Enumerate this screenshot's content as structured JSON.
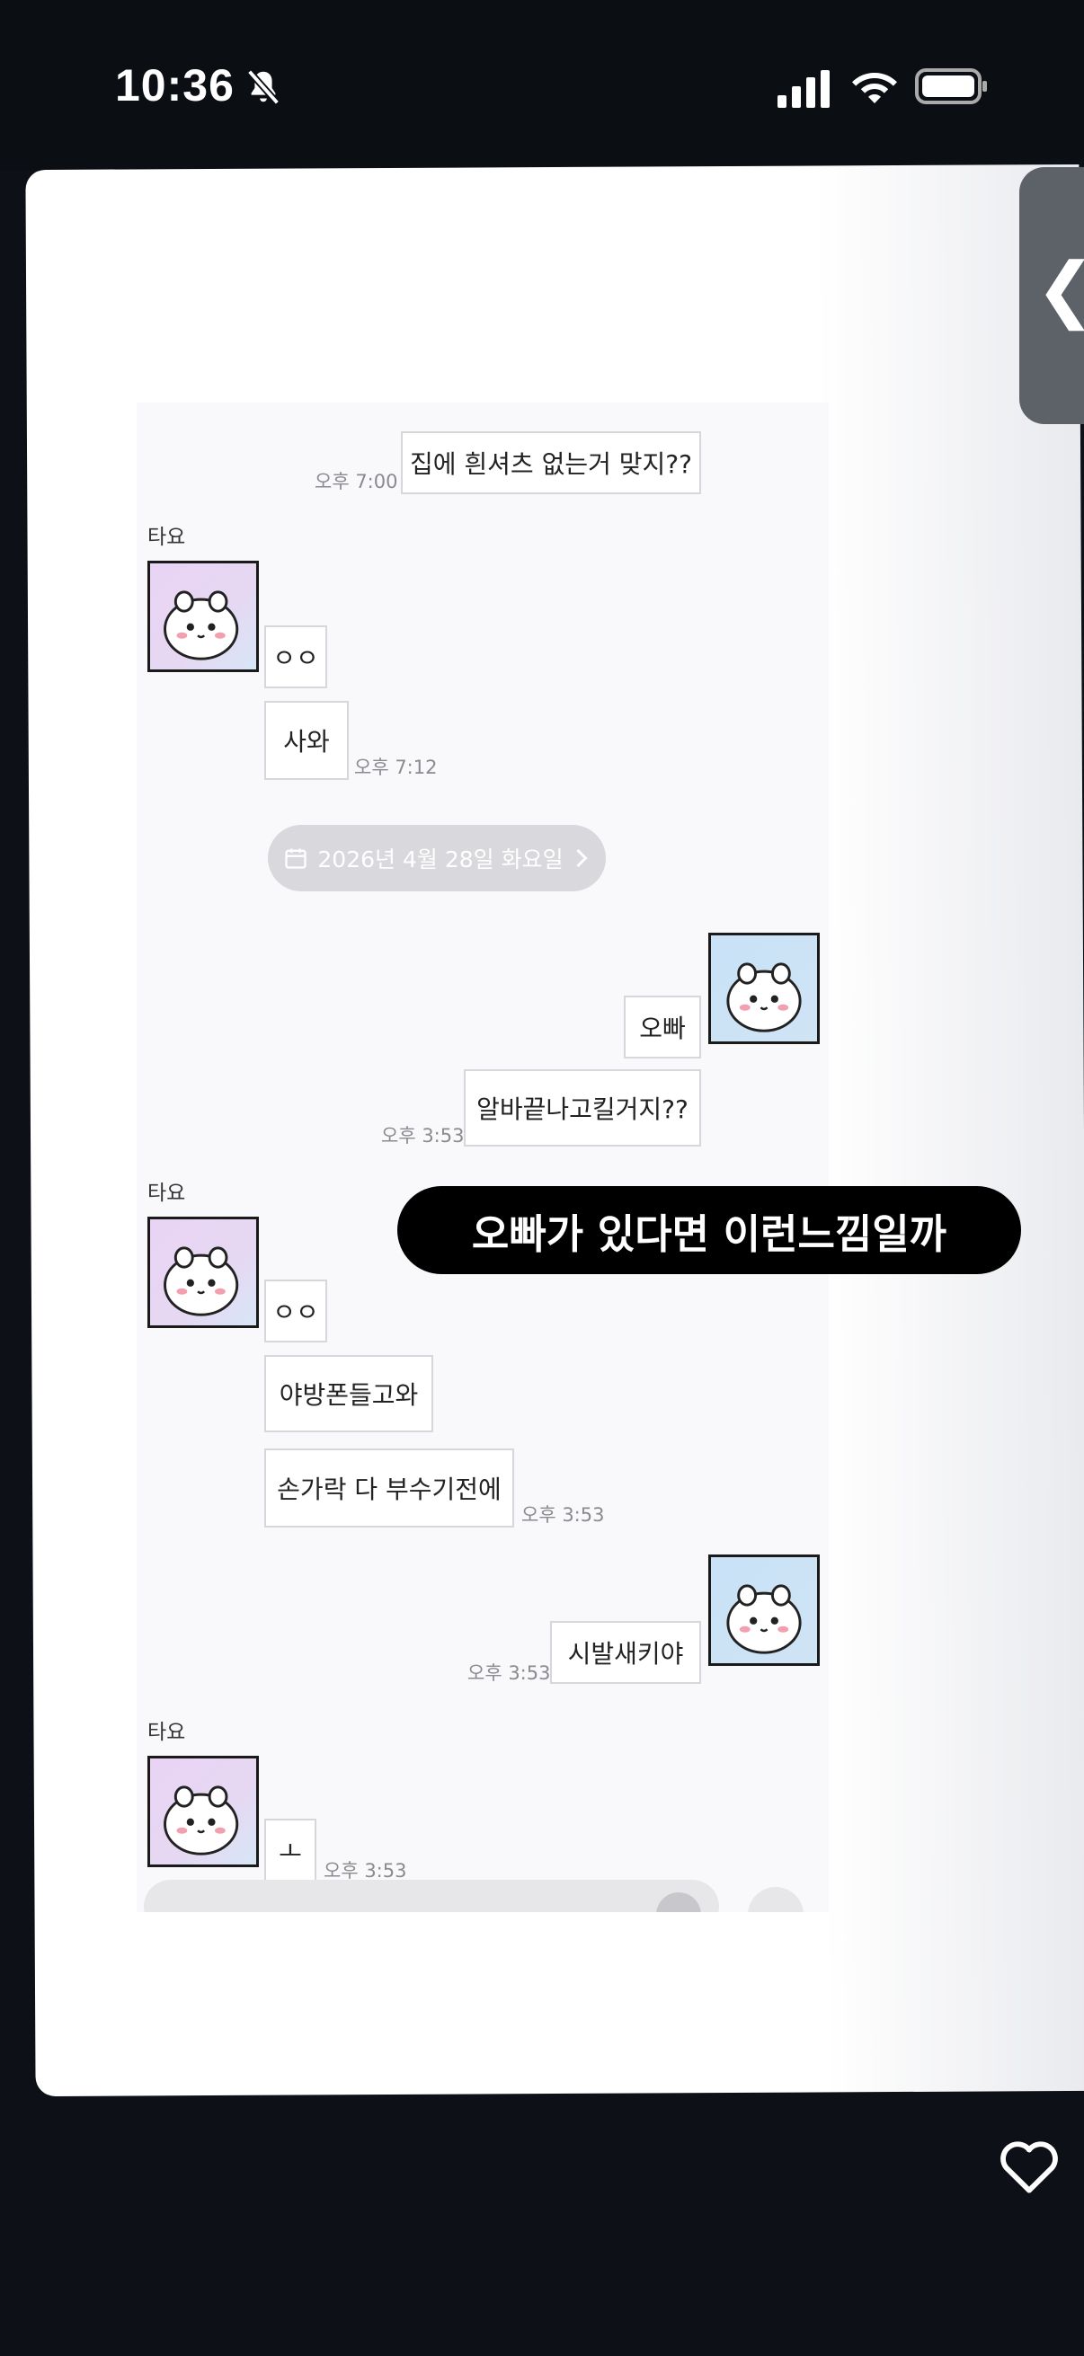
{
  "status_bar": {
    "time": "10:36"
  },
  "side_tab": {
    "label": "❮"
  },
  "chat": {
    "date_separator": "2026년 4월 28일 화요일",
    "messages": [
      {
        "text": "집에 흰셔츠 없는거 맞지??",
        "time": "오후 7:00"
      },
      {
        "sender": "타요"
      },
      {
        "text": "ㅇㅇ"
      },
      {
        "text": "사와",
        "time": "오후 7:12"
      },
      {
        "text": "오빠"
      },
      {
        "text": "알바끝나고킬거지??",
        "time": "오후 3:53"
      },
      {
        "sender": "타요"
      },
      {
        "text": "ㅇㅇ"
      },
      {
        "text": "야방폰들고와"
      },
      {
        "text": "손가락 다 부수기전에",
        "time": "오후 3:53"
      },
      {
        "text": "시발새키야",
        "time": "오후 3:53"
      },
      {
        "sender": "타요"
      },
      {
        "text": "ㅗ",
        "time": "오후 3:53"
      }
    ]
  },
  "caption": "오빠가 있다면 이런느낌일까",
  "colors": {
    "background": "#0d1117",
    "card": "#ffffff",
    "caption_bg": "#000000",
    "date_pill": "#d9d9dd"
  },
  "icons": [
    "bell-slash-icon",
    "cellular-signal-icon",
    "wifi-icon",
    "battery-icon",
    "calendar-icon",
    "chevron-right-icon",
    "heart-icon"
  ]
}
